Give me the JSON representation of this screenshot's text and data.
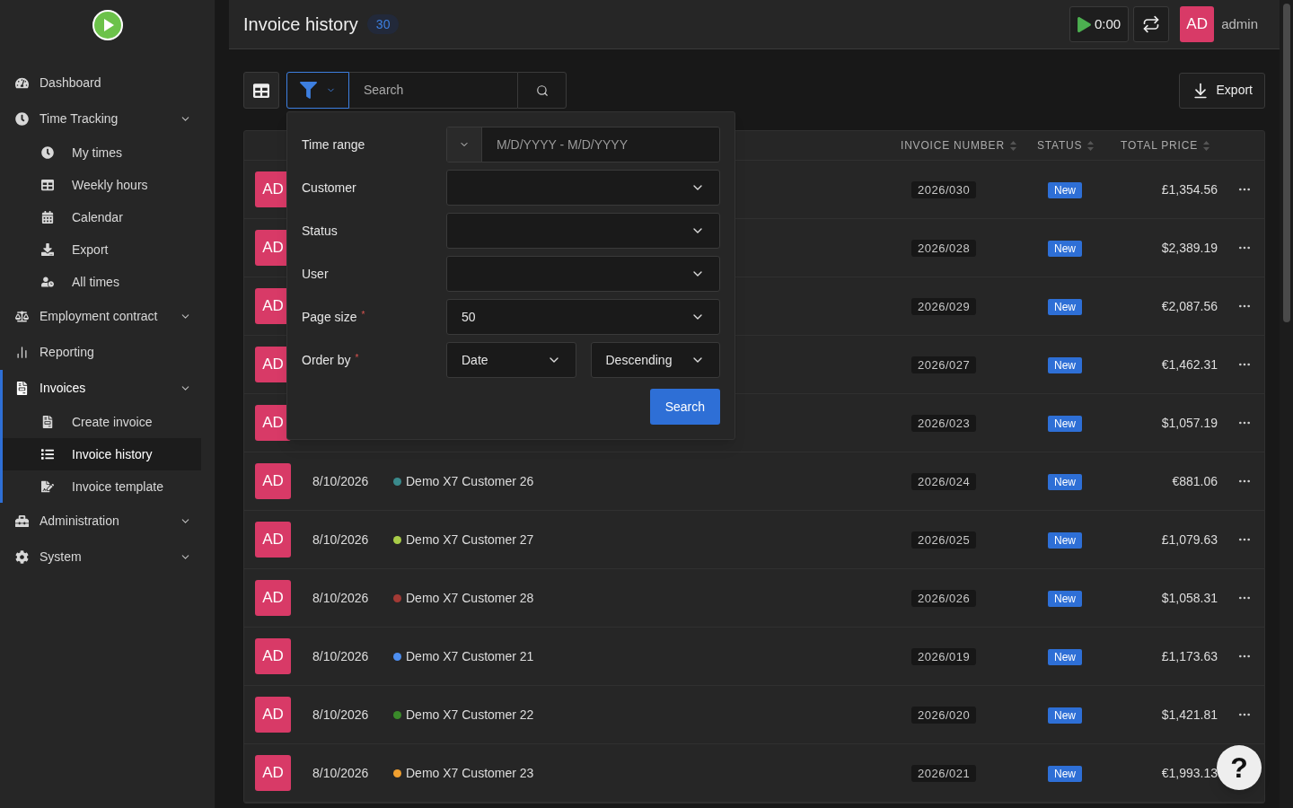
{
  "sidebar": {
    "items": [
      {
        "label": "Dashboard",
        "selected": false
      },
      {
        "label": "Time Tracking",
        "selected": false,
        "has_submenu": true,
        "children": [
          {
            "label": "My times",
            "selected": false
          },
          {
            "label": "Weekly hours",
            "selected": false
          },
          {
            "label": "Calendar",
            "selected": false
          },
          {
            "label": "Export",
            "selected": false
          },
          {
            "label": "All times",
            "selected": false
          }
        ]
      },
      {
        "label": "Employment contract",
        "selected": false,
        "has_submenu": true
      },
      {
        "label": "Reporting",
        "selected": false
      },
      {
        "label": "Invoices",
        "selected": true,
        "has_submenu": true,
        "children": [
          {
            "label": "Create invoice",
            "selected": false
          },
          {
            "label": "Invoice history",
            "selected": true
          },
          {
            "label": "Invoice template",
            "selected": false
          }
        ]
      },
      {
        "label": "Administration",
        "selected": false,
        "has_submenu": true
      },
      {
        "label": "System",
        "selected": false,
        "has_submenu": true
      }
    ]
  },
  "header": {
    "title": "Invoice history",
    "count": "30",
    "timer": "0:00",
    "user_initials": "AD",
    "user_name": "admin"
  },
  "toolbar": {
    "filter_open": true,
    "search": {
      "placeholder": "Search"
    },
    "export_label": "Export"
  },
  "filter": {
    "fields": [
      {
        "kind": "daterange",
        "label": "Time range",
        "required": false,
        "placeholder": "M/D/YYYY - M/D/YYYY"
      },
      {
        "kind": "select",
        "label": "Customer",
        "required": false
      },
      {
        "kind": "select",
        "label": "Status",
        "required": false
      },
      {
        "kind": "select",
        "label": "User",
        "required": false
      },
      {
        "kind": "select",
        "label": "Page size",
        "required": true,
        "value": "50"
      },
      {
        "kind": "double_select",
        "label": "Order by",
        "required": true,
        "values": [
          "Date",
          "Descending"
        ]
      }
    ],
    "required_mark": "*",
    "submit": "Search"
  },
  "table": {
    "columns": [
      "INVOICE NUMBER",
      "STATUS",
      "TOTAL PRICE"
    ],
    "rows": [
      {
        "avatar": "AD",
        "number": "2026/030",
        "status": "New",
        "price": "£1,354.56"
      },
      {
        "avatar": "AD",
        "number": "2026/028",
        "status": "New",
        "price": "$2,389.19"
      },
      {
        "avatar": "AD",
        "number": "2026/029",
        "status": "New",
        "price": "€2,087.56"
      },
      {
        "avatar": "AD",
        "number": "2026/027",
        "status": "New",
        "price": "€1,462.31"
      },
      {
        "avatar": "AD",
        "number": "2026/023",
        "status": "New",
        "price": "$1,057.19"
      },
      {
        "avatar": "AD",
        "date": "8/10/2026",
        "customer": "Demo X7 Customer 26",
        "color": "#3a8a8c",
        "number": "2026/024",
        "status": "New",
        "price": "€881.06"
      },
      {
        "avatar": "AD",
        "date": "8/10/2026",
        "customer": "Demo X7 Customer 27",
        "color": "#a8cc48",
        "number": "2026/025",
        "status": "New",
        "price": "£1,079.63"
      },
      {
        "avatar": "AD",
        "date": "8/10/2026",
        "customer": "Demo X7 Customer 28",
        "color": "#a33a35",
        "number": "2026/026",
        "status": "New",
        "price": "$1,058.31"
      },
      {
        "avatar": "AD",
        "date": "8/10/2026",
        "customer": "Demo X7 Customer 21",
        "color": "#4d8ef0",
        "number": "2026/019",
        "status": "New",
        "price": "£1,173.63"
      },
      {
        "avatar": "AD",
        "date": "8/10/2026",
        "customer": "Demo X7 Customer 22",
        "color": "#3a8a2a",
        "number": "2026/020",
        "status": "New",
        "price": "$1,421.81"
      },
      {
        "avatar": "AD",
        "date": "8/10/2026",
        "customer": "Demo X7 Customer 23",
        "color": "#f0a030",
        "number": "2026/021",
        "status": "New",
        "price": "€1,993.13"
      }
    ]
  },
  "help": {
    "label": "?"
  }
}
